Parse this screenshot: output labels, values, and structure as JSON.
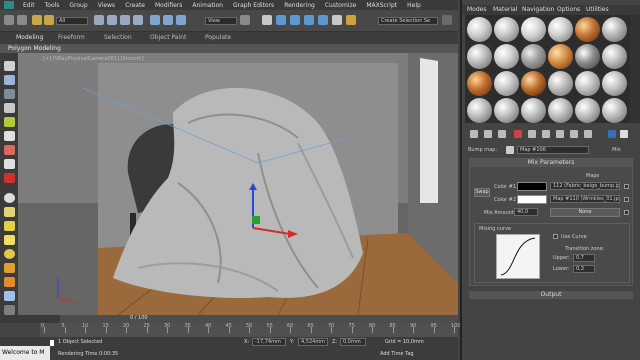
{
  "menu": [
    "Edit",
    "Tools",
    "Group",
    "Views",
    "Create",
    "Modifiers",
    "Animation",
    "Graph Editors",
    "Rendering",
    "Customize",
    "MAXScript",
    "Help"
  ],
  "toolbar": {
    "filter_value": "All",
    "view_value": "View",
    "selection_set_value": "Create Selection Se"
  },
  "ribbon": {
    "tabs": [
      "Modeling",
      "Freeform",
      "Selection",
      "Object Paint",
      "Populate"
    ],
    "active_tab": "Modeling",
    "sub_label": "Polygon Modeling"
  },
  "viewport": {
    "label": "[+] [VRayPhysicalCamera001] [Smooth]"
  },
  "timeline": {
    "frame_text": "0 / 100",
    "ruler_labels": [
      "0",
      "5",
      "10",
      "15",
      "20",
      "25",
      "30",
      "35",
      "40",
      "45",
      "50",
      "55",
      "60",
      "65",
      "70",
      "75",
      "80",
      "85",
      "90",
      "95",
      "100"
    ]
  },
  "status": {
    "welcome": "Welcome to M",
    "objects_selected": "1 Object Selected",
    "render_time": "Rendering Time 0:00:35",
    "x_label": "X:",
    "x_value": "-17,74mm",
    "y_label": "Y:",
    "y_value": "4,524mm",
    "z_label": "Z:",
    "z_value": "0,0mm",
    "grid": "Grid = 10,0mm",
    "add_time_tag": "Add Time Tag"
  },
  "material_editor": {
    "menu": [
      "Modes",
      "Material",
      "Navigation",
      "Options",
      "Utilities"
    ],
    "bump_label": "Bump map:",
    "bump_map_value": "Map #106",
    "type_label": "Mix",
    "mix_parameters_title": "Mix Parameters",
    "maps_header": "Maps",
    "swap_label": "Swap",
    "color1_label": "Color #1",
    "color2_label": "Color #2",
    "map1_value": "112 (Fabric_beige_bump.jpg)",
    "map2_value": "Map #110 (Wrinkles_01.jpg)",
    "mix_amount_label": "Mix Amount:",
    "mix_amount_value": "40,0",
    "mix_map_value": "None",
    "mixing_curve_label": "Mixing curve",
    "use_curve_label": "Use Curve",
    "transition_zone_label": "Transition zone:",
    "upper_label": "Upper:",
    "upper_value": "0,7",
    "lower_label": "Lower:",
    "lower_value": "0,3",
    "output_label": "Output"
  }
}
